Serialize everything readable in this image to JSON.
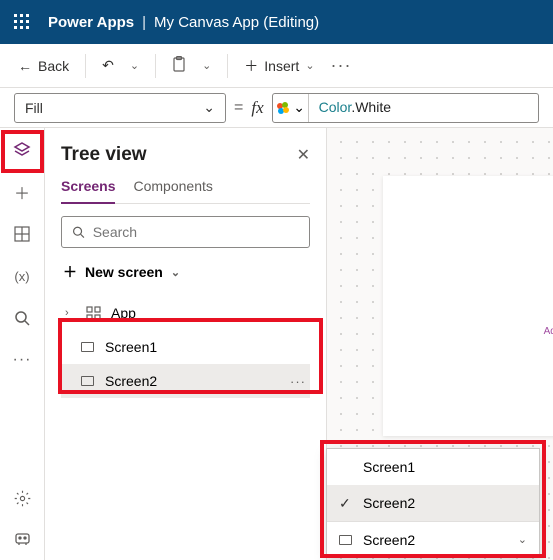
{
  "titlebar": {
    "app": "Power Apps",
    "doc": "My Canvas App (Editing)"
  },
  "cmdbar": {
    "back": "Back",
    "insert": "Insert"
  },
  "fbar": {
    "property": "Fill",
    "formula_ns": "Color",
    "formula_prop": "White"
  },
  "tree": {
    "title": "Tree view",
    "tabs": {
      "screens": "Screens",
      "components": "Components"
    },
    "search_placeholder": "Search",
    "new_screen": "New screen",
    "app": "App",
    "screen1": "Screen1",
    "screen2": "Screen2"
  },
  "canvas": {
    "hint": "Add an item"
  },
  "popup": {
    "screen1": "Screen1",
    "screen2": "Screen2",
    "screen2b": "Screen2"
  }
}
